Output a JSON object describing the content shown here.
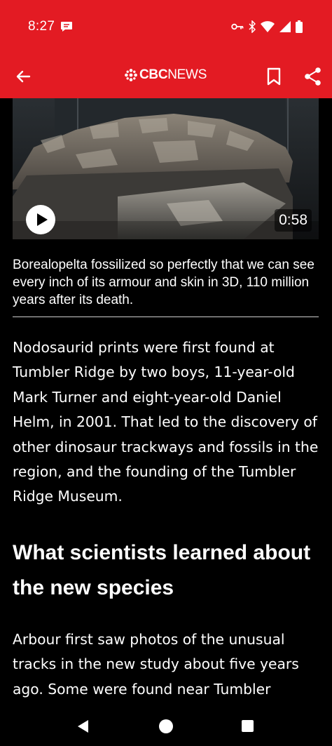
{
  "status_bar": {
    "time": "8:27",
    "background": "#e31b23",
    "icons": [
      "message-icon",
      "vpn-key-icon",
      "bluetooth-icon",
      "wifi-icon",
      "cell-signal-icon",
      "battery-icon"
    ]
  },
  "app_bar": {
    "logo_cbc": "CBC",
    "logo_news": "NEWS",
    "icons": [
      "back-arrow-icon",
      "cbc-gem-icon",
      "bookmark-icon",
      "share-icon"
    ]
  },
  "video": {
    "duration": "0:58",
    "icons": [
      "play-icon"
    ]
  },
  "article": {
    "caption": "Borealopelta fossilized so perfectly that we can see every inch of its armour and skin in 3D, 110 million years after its death.",
    "paragraph1": "Nodosaurid prints were first found at Tumbler Ridge by two boys, 11-year-old Mark Turner and eight-year-old Daniel Helm, in 2001. That led to the discovery of other dinosaur trackways and fossils in the region, and the founding of the Tumbler Ridge Museum.",
    "heading": "What scientists learned about the new species",
    "paragraph2": "Arbour first saw photos of the unusual tracks in the new study about five years ago. Some were found near Tumbler"
  },
  "nav_bar": {
    "icons": [
      "nav-back-icon",
      "nav-home-icon",
      "nav-recents-icon"
    ]
  }
}
